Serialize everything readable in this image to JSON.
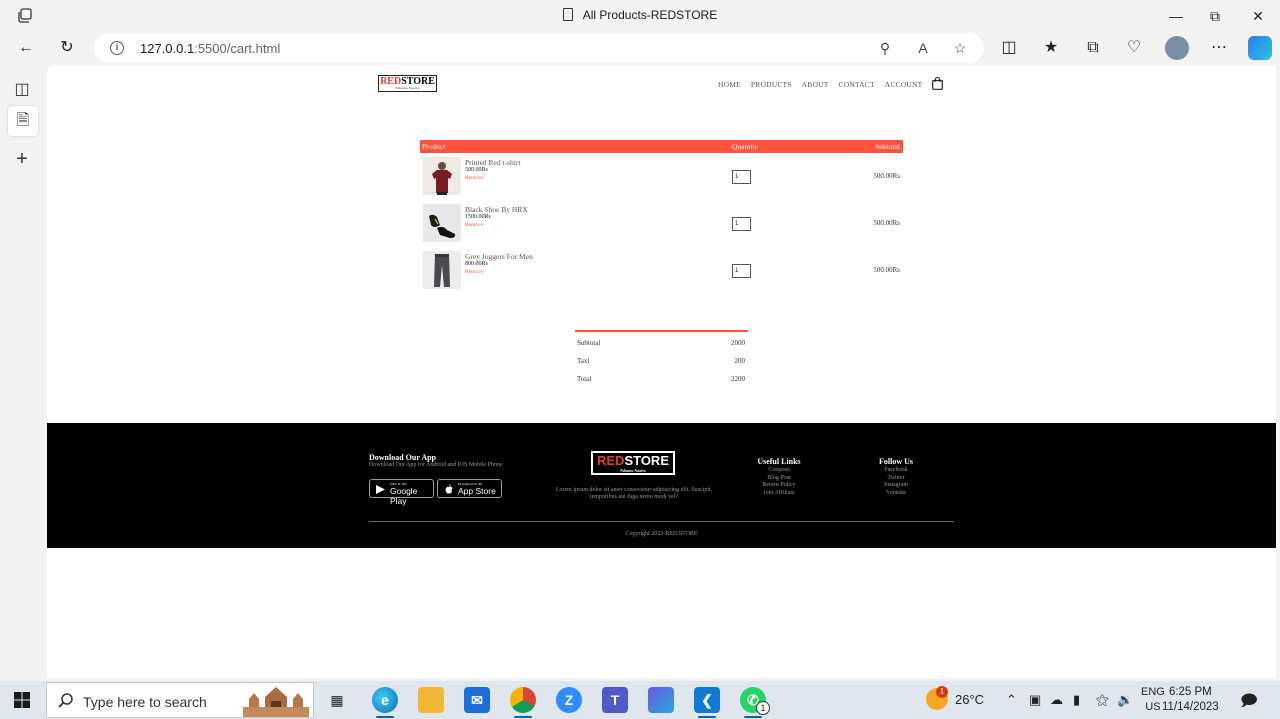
{
  "browser": {
    "window_title": "All Products-REDSTORE",
    "url_host": "127.0.0.1",
    "url_rest": ":5500/cart.html"
  },
  "site": {
    "logo_red": "RED",
    "logo_black": "STORE",
    "logo_tag": "Ndanna Naaive",
    "nav": [
      "HOME",
      "PRODUCTS",
      "ABOUT",
      "CONTACT",
      "ACCOUNT"
    ]
  },
  "cart": {
    "headers": {
      "product": "Product",
      "quantity": "Quantity",
      "subtotal": "Subtotal"
    },
    "items": [
      {
        "name": "Printed Red t-shirt",
        "price": "500.00Rs",
        "remove": "Remove",
        "qty": "1",
        "subtotal": "500.00Rs"
      },
      {
        "name": "Black Shoe By HRX",
        "price": "1500.00Rs",
        "remove": "Remove",
        "qty": "1",
        "subtotal": "500.00Rs"
      },
      {
        "name": "Grey Joggers For Men",
        "price": "800.00Rs",
        "remove": "Remove",
        "qty": "1",
        "subtotal": "500.00Rs"
      }
    ],
    "totals": [
      {
        "label": "Subtotal",
        "value": "2000"
      },
      {
        "label": "Taxl",
        "value": "200"
      },
      {
        "label": "Total",
        "value": "2200"
      }
    ]
  },
  "footer": {
    "download_title": "Download Our App",
    "download_sub": "Download Our App for Android and IOS Mobile Phone",
    "google_small": "GET IT ON",
    "google_big": "Google Play",
    "apple_small": "Download on the",
    "apple_big": "App Store",
    "logo_red": "RED",
    "logo_black": "STORE",
    "logo_tag": "Ndanna Naaive",
    "lorem": "Lorem ipsum dolor sit amet consectetur adipisicing elit. Suscipit, temporibus aut fuga nemo modi vel?",
    "useful_title": "Useful Links",
    "useful_links": [
      "Coupons",
      "Blog Post",
      "Return Policy",
      "Join Affiliate"
    ],
    "follow_title": "Follow Us",
    "follow_links": [
      "Facebook",
      "Twitter",
      "Instagram",
      "Youtube"
    ],
    "copyright": "Copyright 2023-RED STORE"
  },
  "taskbar": {
    "search_placeholder": "Type here to search",
    "weather": "26°C",
    "weather_badge": "1",
    "lang_top": "ENG",
    "lang_bottom": "US",
    "time": "6:25 PM",
    "date": "11/14/2023",
    "whatsapp_badge": "1"
  },
  "colors": {
    "accent": "#ff523b",
    "footer_bg": "#000000",
    "edge_blue": "#0067c0"
  }
}
